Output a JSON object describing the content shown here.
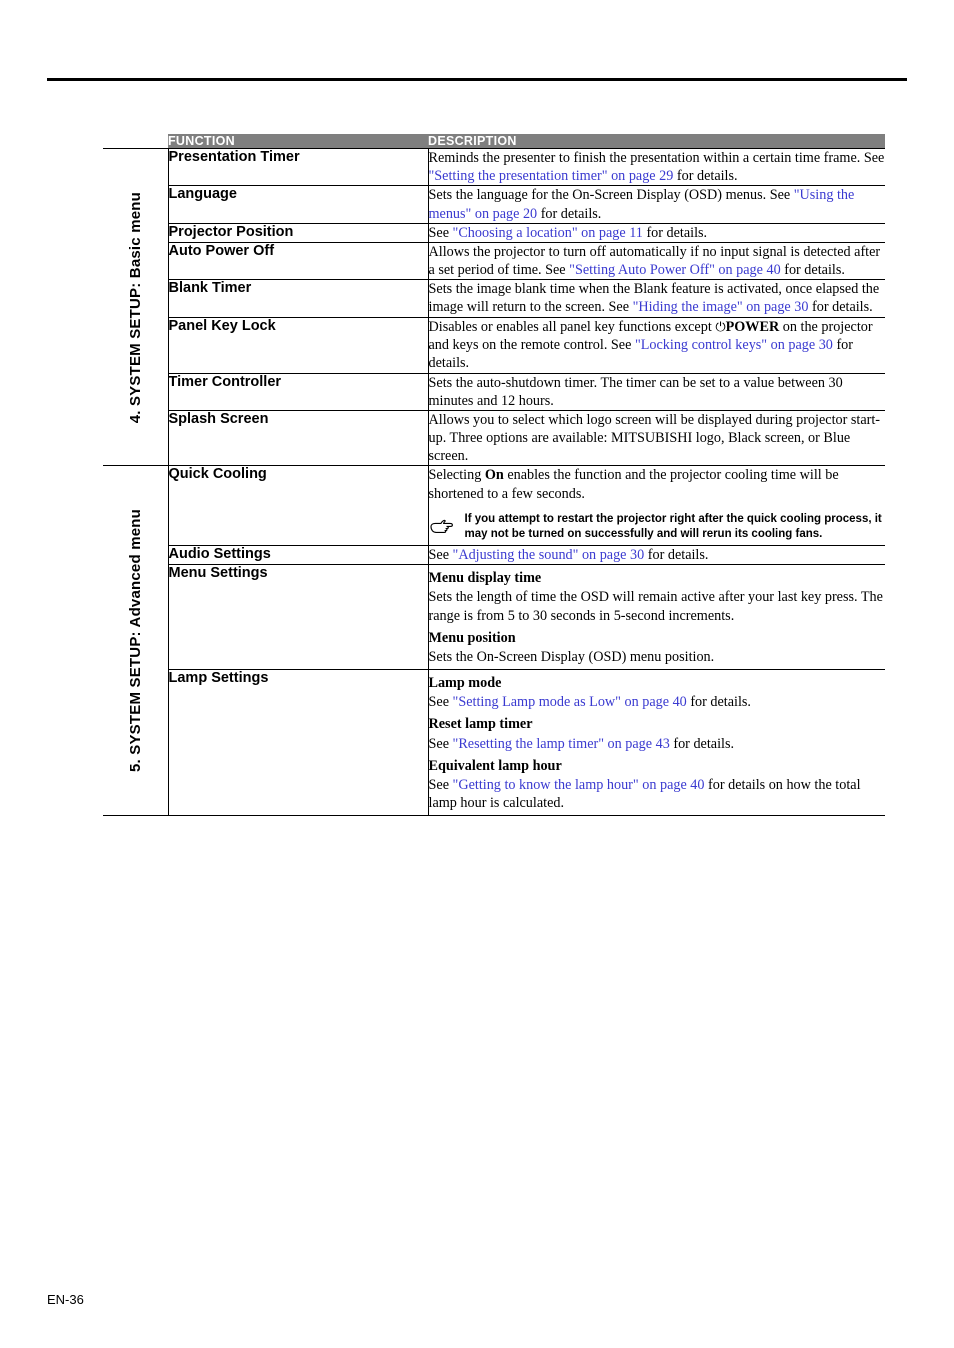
{
  "page": {
    "footer": "EN-36"
  },
  "table": {
    "headers": {
      "function": "FUNCTION",
      "description": "DESCRIPTION"
    },
    "sections": [
      {
        "side_label": "4. SYSTEM SETUP: Basic menu",
        "rows": [
          {
            "function": "Presentation Timer",
            "description_parts": [
              {
                "t": "Reminds the presenter to finish the presentation within a certain time frame. See ",
                "k": "plain"
              },
              {
                "t": "\"Setting the presentation timer\" on page 29",
                "k": "link"
              },
              {
                "t": " for details.",
                "k": "plain"
              }
            ]
          },
          {
            "function": "Language",
            "description_parts": [
              {
                "t": "Sets the language for the On-Screen Display (OSD) menus. See ",
                "k": "plain"
              },
              {
                "t": "\"Using the menus\" on page 20",
                "k": "link"
              },
              {
                "t": " for details.",
                "k": "plain"
              }
            ]
          },
          {
            "function": "Projector Position",
            "description_parts": [
              {
                "t": "See ",
                "k": "plain"
              },
              {
                "t": "\"Choosing a location\" on page 11",
                "k": "link"
              },
              {
                "t": " for details.",
                "k": "plain"
              }
            ]
          },
          {
            "function": "Auto Power Off",
            "description_parts": [
              {
                "t": "Allows the projector to turn off automatically if no input signal is detected after a set period of time. See ",
                "k": "plain"
              },
              {
                "t": "\"Setting Auto Power Off\" on page 40",
                "k": "link"
              },
              {
                "t": " for details.",
                "k": "plain"
              }
            ]
          },
          {
            "function": "Blank Timer",
            "description_parts": [
              {
                "t": "Sets the image blank time when the Blank feature is activated, once elapsed the image will return to the screen. See ",
                "k": "plain"
              },
              {
                "t": "\"Hiding the image\" on page 30",
                "k": "link"
              },
              {
                "t": " for details.",
                "k": "plain"
              }
            ]
          },
          {
            "function": "Panel Key Lock",
            "description_parts": [
              {
                "t": "Disables or enables all panel key functions except ",
                "k": "plain"
              },
              {
                "t": "⏻",
                "k": "glyph"
              },
              {
                "t": "POWER",
                "k": "bold"
              },
              {
                "t": " on the projector and keys on the remote control. See ",
                "k": "plain"
              },
              {
                "t": "\"Locking control keys\" on page 30",
                "k": "link"
              },
              {
                "t": " for details.",
                "k": "plain"
              }
            ]
          },
          {
            "function": "Timer Controller",
            "description_parts": [
              {
                "t": "Sets the auto-shutdown timer. The timer can be set to a value between 30 minutes and 12 hours.",
                "k": "plain"
              }
            ]
          },
          {
            "function": "Splash Screen",
            "description_parts": [
              {
                "t": "Allows you to select which logo screen will be displayed during projector start-up. Three options are available: MITSUBISHI logo, Black screen, or Blue screen.",
                "k": "plain"
              }
            ]
          }
        ]
      },
      {
        "side_label": "5. SYSTEM SETUP: Advanced menu",
        "rows": [
          {
            "function": "Quick Cooling",
            "description_parts": [
              {
                "t": "Selecting ",
                "k": "plain"
              },
              {
                "t": "On",
                "k": "bold"
              },
              {
                "t": " enables the function and the projector cooling time will be shortened to a few seconds.",
                "k": "plain"
              }
            ],
            "note": "If you attempt to restart the projector right after the quick cooling process, it may not be turned on successfully and will rerun its cooling fans."
          },
          {
            "function": "Audio Settings",
            "description_parts": [
              {
                "t": "See ",
                "k": "plain"
              },
              {
                "t": "\"Adjusting the sound\" on page 30",
                "k": "link"
              },
              {
                "t": " for details.",
                "k": "plain"
              }
            ]
          },
          {
            "function": "Menu Settings",
            "subsections": [
              {
                "heading": "Menu display time",
                "parts": [
                  {
                    "t": "Sets the length of time the OSD will remain active after your last key press. The range is from 5 to 30 seconds in 5-second increments.",
                    "k": "plain"
                  }
                ]
              },
              {
                "heading": "Menu position",
                "parts": [
                  {
                    "t": "Sets the On-Screen Display (OSD) menu position.",
                    "k": "plain"
                  }
                ]
              }
            ]
          },
          {
            "function": "Lamp Settings",
            "subsections": [
              {
                "heading": "Lamp mode",
                "parts": [
                  {
                    "t": "See ",
                    "k": "plain"
                  },
                  {
                    "t": "\"Setting Lamp mode as Low\" on page 40",
                    "k": "link"
                  },
                  {
                    "t": " for details.",
                    "k": "plain"
                  }
                ]
              },
              {
                "heading": "Reset lamp timer",
                "parts": [
                  {
                    "t": "See ",
                    "k": "plain"
                  },
                  {
                    "t": "\"Resetting the lamp timer\" on page 43",
                    "k": "link"
                  },
                  {
                    "t": " for details.",
                    "k": "plain"
                  }
                ]
              },
              {
                "heading": "Equivalent lamp hour",
                "parts": [
                  {
                    "t": "See ",
                    "k": "plain"
                  },
                  {
                    "t": "\"Getting to know the lamp hour\" on page 40",
                    "k": "link"
                  },
                  {
                    "t": " for details on how the total lamp hour is calculated.",
                    "k": "plain"
                  }
                ]
              }
            ]
          }
        ]
      }
    ]
  }
}
